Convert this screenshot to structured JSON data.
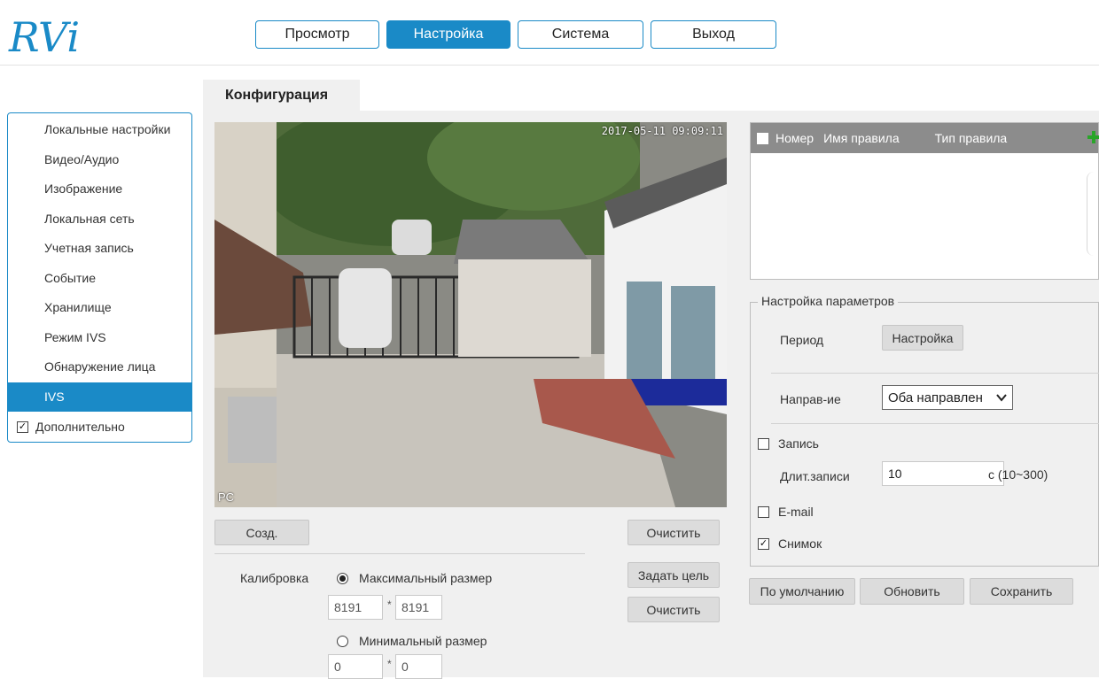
{
  "header": {
    "logo_text": "RVi",
    "nav": [
      "Просмотр",
      "Настройка",
      "Система",
      "Выход"
    ],
    "active_nav": "Настройка"
  },
  "sidebar": {
    "items": [
      "Локальные настройки",
      "Видео/Аудио",
      "Изображение",
      "Локальная сеть",
      "Учетная запись",
      "Событие",
      "Хранилище",
      "Режим IVS",
      "Обнаружение лица",
      "IVS"
    ],
    "active": "IVS",
    "extra_label": "Дополнительно",
    "extra_checked": true
  },
  "content": {
    "tab": "Конфигурация",
    "video": {
      "timestamp": "2017-05-11 09:09:11",
      "overlay_label": "PC"
    },
    "buttons": {
      "create": "Созд.",
      "clear_top": "Очистить",
      "set_target": "Задать цель",
      "clear_bottom": "Очистить"
    },
    "calibration": {
      "label": "Калибровка",
      "max_label": "Максимальный размер",
      "max_w": "8191",
      "max_h": "8191",
      "min_label": "Минимальный размер",
      "min_w": "0",
      "min_h": "0",
      "selected": "max"
    }
  },
  "rules": {
    "headers": [
      "Номер",
      "Имя правила",
      "Тип правила"
    ]
  },
  "params": {
    "legend": "Настройка параметров",
    "period_label": "Период",
    "period_button": "Настройка",
    "direction_label": "Направ-ие",
    "direction_value": "Оба направлен",
    "record_label": "Запись",
    "record_checked": false,
    "duration_label": "Длит.записи",
    "duration_value": "10",
    "duration_unit": "с (10~300)",
    "email_label": "E-mail",
    "email_checked": false,
    "snapshot_label": "Снимок",
    "snapshot_checked": true
  },
  "footer_buttons": {
    "default": "По умолчанию",
    "refresh": "Обновить",
    "save": "Сохранить"
  },
  "colors": {
    "accent": "#1a8ac7",
    "logo": "#1a8ac7",
    "plus": "#2aa52a",
    "table_header": "#8c8c8c",
    "panel_bg": "#f0f0f0"
  }
}
